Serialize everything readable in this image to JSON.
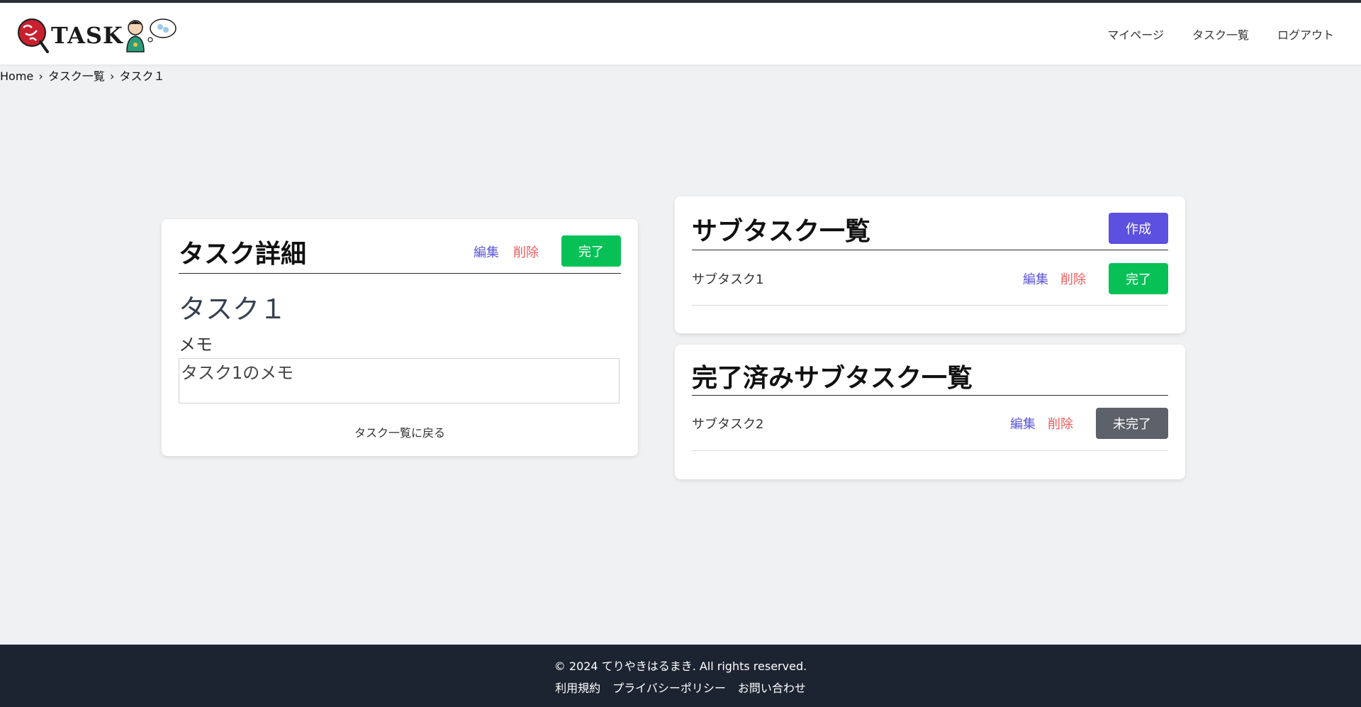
{
  "header": {
    "logo_text": "TASK",
    "nav": [
      "マイページ",
      "タスク一覧",
      "ログアウト"
    ]
  },
  "breadcrumb": [
    "Home",
    "›",
    "タスク一覧",
    "›",
    "タスク１"
  ],
  "task_detail": {
    "title": "タスク詳細",
    "edit_label": "編集",
    "delete_label": "削除",
    "complete_label": "完了",
    "task_name": "タスク１",
    "memo_label": "メモ",
    "memo_value": "タスク1のメモ",
    "back_label": "タスク一覧に戻る"
  },
  "subtasks": {
    "title": "サブタスク一覧",
    "create_label": "作成",
    "items": [
      {
        "name": "サブタスク1",
        "edit": "編集",
        "delete": "削除",
        "action": "完了"
      }
    ]
  },
  "completed_subtasks": {
    "title": "完了済みサブタスク一覧",
    "items": [
      {
        "name": "サブタスク2",
        "edit": "編集",
        "delete": "削除",
        "action": "未完了"
      }
    ]
  },
  "footer": {
    "copyright": "© 2024 てりやきはるまき. All rights reserved.",
    "links": [
      "利用規約",
      "プライバシーポリシー",
      "お問い合わせ"
    ]
  },
  "colors": {
    "accent_purple": "#5b50e0",
    "complete_green": "#07c157",
    "delete_red": "#ef5a5a",
    "uncomplete_gray": "#5d6169",
    "footer_bg": "#1c2431"
  }
}
